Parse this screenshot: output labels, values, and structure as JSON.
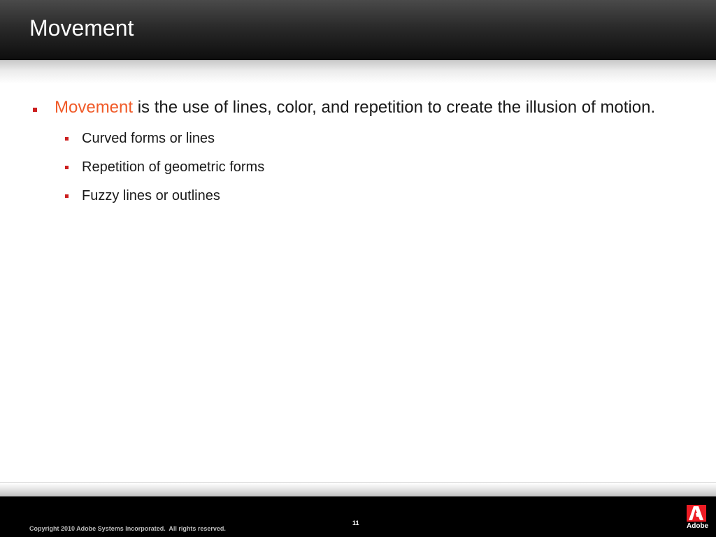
{
  "slide": {
    "title": "Movement",
    "bullets": [
      {
        "accent": "Movement",
        "text": " is the use of lines, color, and repetition to create the illusion of motion.",
        "sub_bullets": [
          "Curved forms or lines",
          "Repetition of geometric forms",
          "Fuzzy lines or outlines"
        ]
      }
    ]
  },
  "footer": {
    "copyright": "Copyright 2010 Adobe Systems Incorporated.  All rights reserved.",
    "page_number": "11",
    "logo_text": "Adobe"
  },
  "colors": {
    "accent": "#f05a28",
    "bullet": "#cc1f1f",
    "header_dark": "#0d0d0d",
    "logo_red": "#ed1c24"
  }
}
